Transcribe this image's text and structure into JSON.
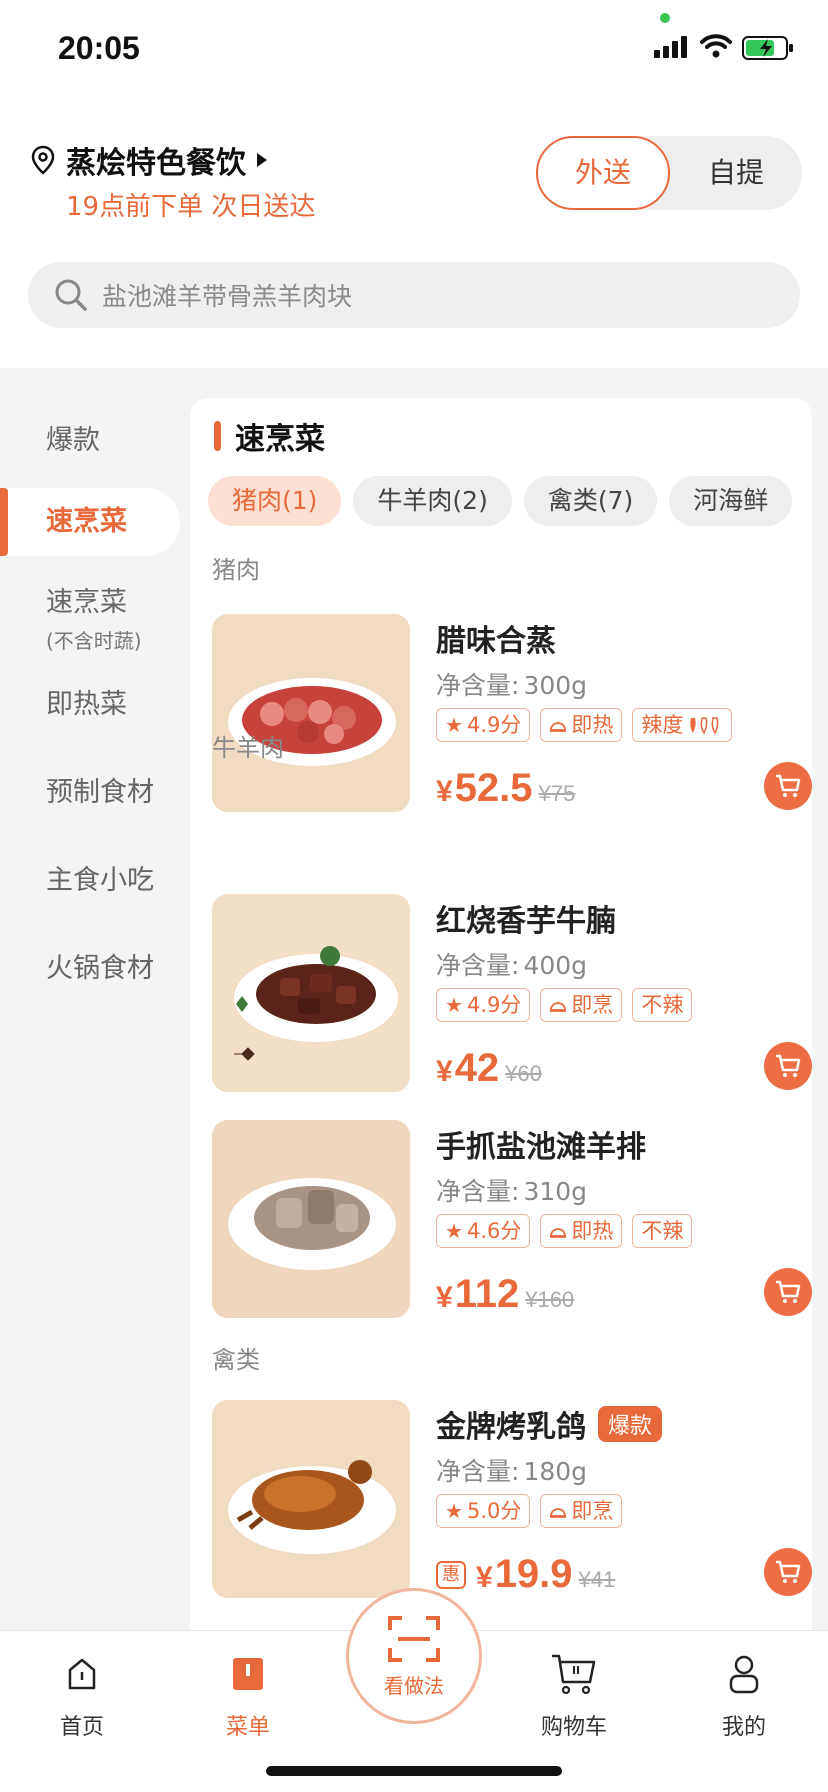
{
  "status_bar": {
    "time": "20:05"
  },
  "header": {
    "store_name": "蒸烩特色餐饮",
    "delivery_note": "19点前下单 次日送达",
    "mode_active": "外送",
    "mode_inactive": "自提"
  },
  "search": {
    "placeholder": "盐池滩羊带骨羔羊肉块"
  },
  "sidebar": {
    "items": [
      {
        "label": "爆款"
      },
      {
        "label": "速烹菜"
      },
      {
        "label": "速烹菜",
        "sub": "(不含时蔬)"
      },
      {
        "label": "即热菜"
      },
      {
        "label": "预制食材"
      },
      {
        "label": "主食小吃"
      },
      {
        "label": "火锅食材"
      }
    ]
  },
  "section": {
    "title": "速烹菜",
    "chips": [
      "猪肉(1)",
      "牛羊肉(2)",
      "禽类(7)",
      "河海鲜"
    ]
  },
  "groups": {
    "pork": "猪肉",
    "beef_lamb": "牛羊肉",
    "poultry": "禽类"
  },
  "products": [
    {
      "name": "腊味合蒸",
      "spec_label": "净含量:",
      "spec": "300g",
      "rating": "4.9分",
      "method": "即热",
      "spice": "辣度",
      "price_symbol": "¥",
      "price": "52.5",
      "original": "¥75"
    },
    {
      "name": "红烧香芋牛腩",
      "spec_label": "净含量:",
      "spec": "400g",
      "rating": "4.9分",
      "method": "即烹",
      "spice": "不辣",
      "price_symbol": "¥",
      "price": "42",
      "original": "¥60"
    },
    {
      "name": "手抓盐池滩羊排",
      "spec_label": "净含量:",
      "spec": "310g",
      "rating": "4.6分",
      "method": "即热",
      "spice": "不辣",
      "price_symbol": "¥",
      "price": "112",
      "original": "¥160"
    },
    {
      "name": "金牌烤乳鸽",
      "badge": "爆款",
      "spec_label": "净含量:",
      "spec": "180g",
      "rating": "5.0分",
      "method": "即烹",
      "coupon": "惠",
      "price_symbol": "¥",
      "price": "19.9",
      "original": "¥41"
    }
  ],
  "tabbar": {
    "home": "首页",
    "menu": "菜单",
    "center": "看做法",
    "cart": "购物车",
    "mine": "我的"
  },
  "colors": {
    "accent": "#e8693a",
    "accent_light": "#fde0d3"
  }
}
